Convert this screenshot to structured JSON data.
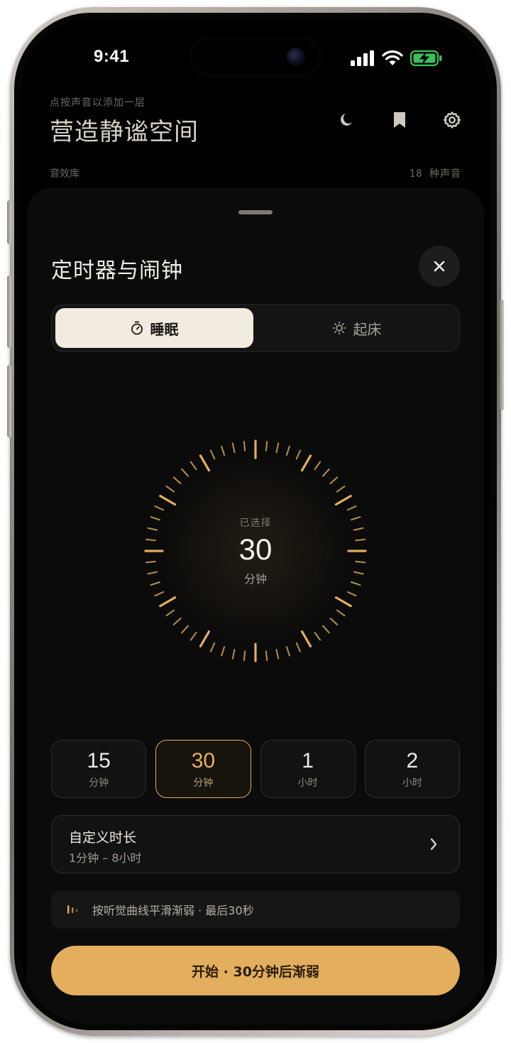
{
  "status_bar": {
    "time": "9:41"
  },
  "header": {
    "hint": "点按声音以添加一层",
    "title": "营造静谧空间",
    "icons": [
      "moon-icon",
      "bookmark-icon",
      "gear-icon"
    ]
  },
  "library": {
    "label": "音效库",
    "count": "18 种声音"
  },
  "sheet": {
    "title": "定时器与闹钟",
    "tabs": [
      {
        "label": "睡眠",
        "icon": "stopwatch-icon",
        "active": true
      },
      {
        "label": "起床",
        "icon": "sun-icon",
        "active": false
      }
    ],
    "dial": {
      "label": "已选择",
      "value": "30",
      "unit": "分钟",
      "accent": "#e3ae5d"
    },
    "presets": [
      {
        "value": "15",
        "unit": "分钟",
        "selected": false
      },
      {
        "value": "30",
        "unit": "分钟",
        "selected": true
      },
      {
        "value": "1",
        "unit": "小时",
        "selected": false
      },
      {
        "value": "2",
        "unit": "小时",
        "selected": false
      }
    ],
    "custom": {
      "title": "自定义时长",
      "range": "1分钟 – 8小时"
    },
    "fade_note": "按听觉曲线平滑渐弱 · 最后30秒",
    "start_button": "开始 · 30分钟后渐弱"
  }
}
